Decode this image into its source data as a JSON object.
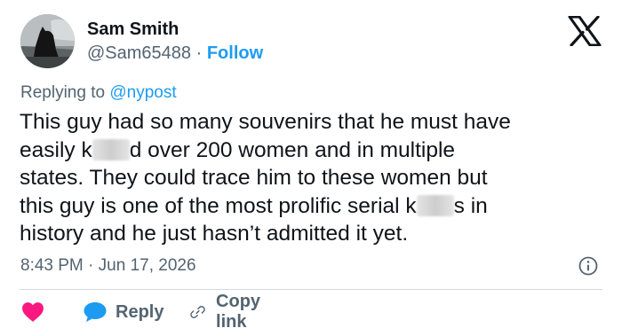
{
  "author": {
    "name": "Sam Smith",
    "handle": "@Sam65488",
    "separator": "·",
    "follow_label": "Follow"
  },
  "reply_context": {
    "prefix": "Replying to",
    "mention": "@nypost"
  },
  "body_lines": [
    [
      "This guy had so many souvenirs that he must have"
    ],
    [
      "easily k",
      "d over 200 women and in multiple"
    ],
    [
      "states. They could trace him to these women but"
    ],
    [
      "this guy is one of the most prolific serial k",
      "s in"
    ],
    [
      "history and he just hasn’t admitted it yet."
    ]
  ],
  "timestamp": {
    "time": "8:43 PM",
    "separator": "·",
    "date": "Jun 17, 2026"
  },
  "actions": {
    "reply_label": "Reply",
    "copy_link_label": "Copy link"
  },
  "icons": {
    "brand": "x-logo-icon",
    "like": "heart-icon",
    "reply": "speech-bubble-icon",
    "copy": "link-icon",
    "info": "info-icon"
  },
  "colors": {
    "accent": "#1d9bf0",
    "like": "#f91880",
    "text": "#0f1419",
    "muted": "#536471"
  }
}
